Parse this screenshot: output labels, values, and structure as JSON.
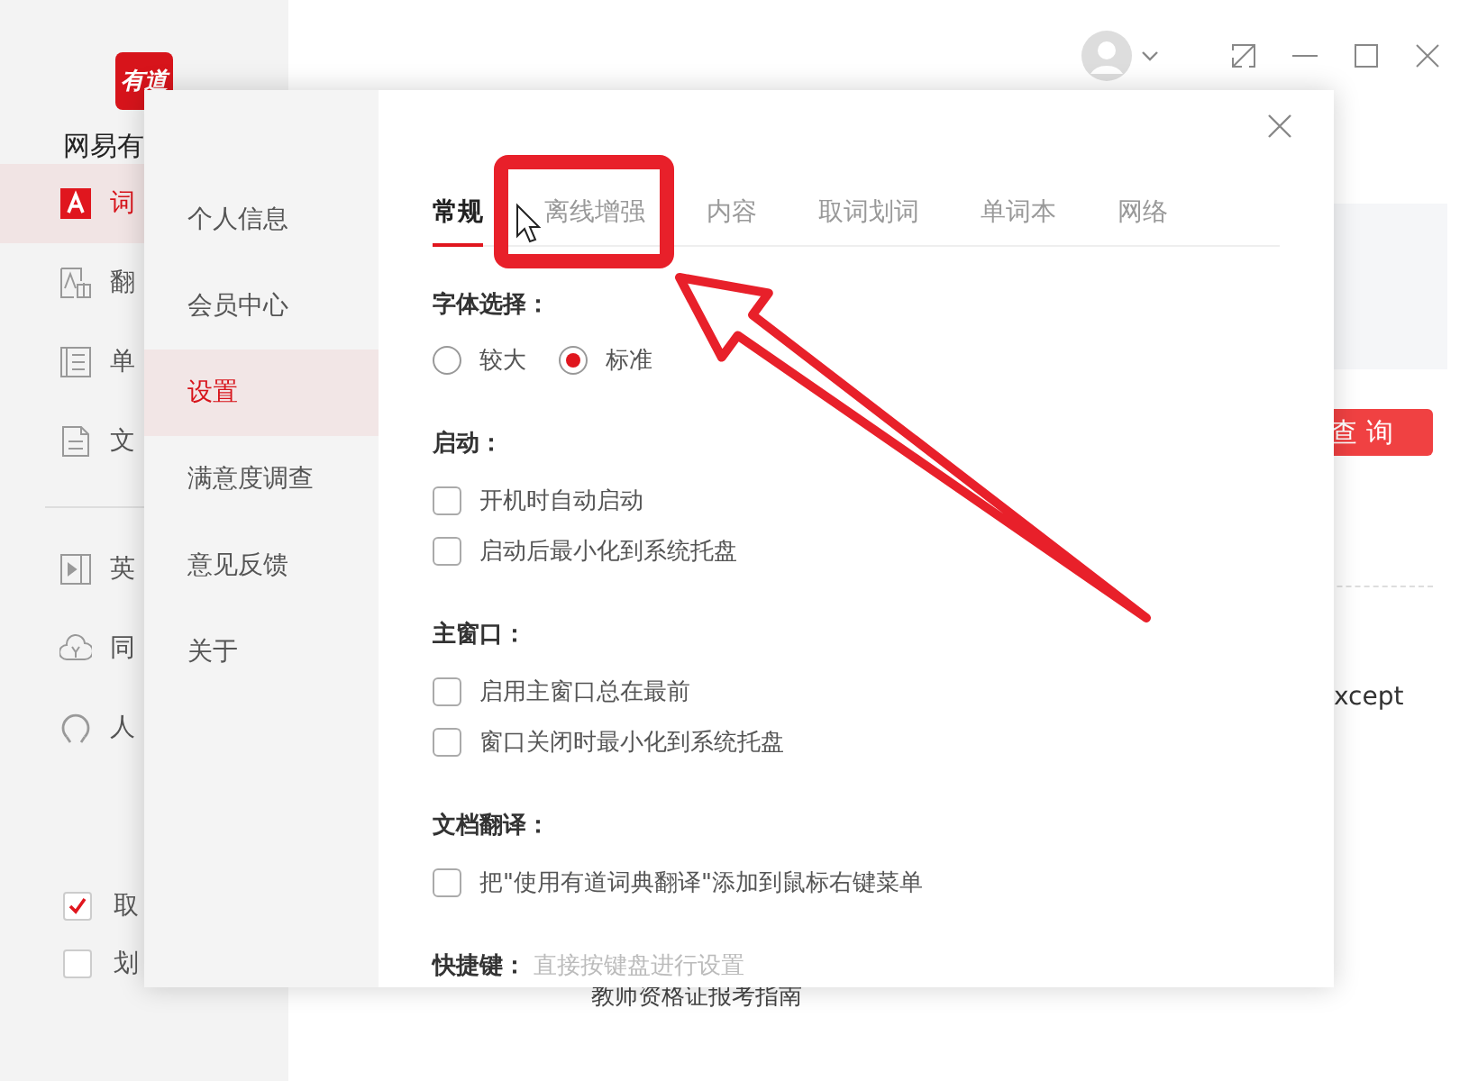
{
  "app": {
    "logo": "有道",
    "name": "网易有",
    "nav": [
      {
        "label": "词",
        "kind": "dict",
        "selected": true
      },
      {
        "label": "翻",
        "kind": "translate",
        "selected": false
      },
      {
        "label": "单",
        "kind": "wordbook",
        "selected": false
      },
      {
        "label": "文",
        "kind": "document",
        "selected": false
      }
    ],
    "nav_more": [
      {
        "label": "英",
        "kind": "video",
        "selected": false
      },
      {
        "label": "同",
        "kind": "cloud",
        "selected": false
      },
      {
        "label": "人",
        "kind": "headset",
        "selected": false
      }
    ],
    "toggles": [
      {
        "label": "取",
        "checked": true
      },
      {
        "label": "划",
        "checked": false
      }
    ],
    "query_button": "查 询",
    "snippet": "xcept",
    "bottom_text": "教师资格证报考指南"
  },
  "dialog": {
    "nav": [
      {
        "label": "个人信息",
        "selected": false
      },
      {
        "label": "会员中心",
        "selected": false
      },
      {
        "label": "设置",
        "selected": true
      },
      {
        "label": "满意度调查",
        "selected": false
      },
      {
        "label": "意见反馈",
        "selected": false
      },
      {
        "label": "关于",
        "selected": false
      }
    ],
    "tabs": [
      {
        "label": "常规",
        "selected": true
      },
      {
        "label": "离线增强",
        "selected": false
      },
      {
        "label": "内容",
        "selected": false
      },
      {
        "label": "取词划词",
        "selected": false
      },
      {
        "label": "单词本",
        "selected": false
      },
      {
        "label": "网络",
        "selected": false
      }
    ],
    "sections": [
      {
        "title": "字体选择：",
        "kind": "radio",
        "options": [
          {
            "label": "较大",
            "selected": false
          },
          {
            "label": "标准",
            "selected": true
          }
        ]
      },
      {
        "title": "启动：",
        "kind": "checkbox",
        "options": [
          {
            "label": "开机时自动启动",
            "checked": false
          },
          {
            "label": "启动后最小化到系统托盘",
            "checked": false
          }
        ]
      },
      {
        "title": "主窗口：",
        "kind": "checkbox",
        "options": [
          {
            "label": "启用主窗口总在最前",
            "checked": false
          },
          {
            "label": "窗口关闭时最小化到系统托盘",
            "checked": false
          }
        ]
      },
      {
        "title": "文档翻译：",
        "kind": "checkbox",
        "options": [
          {
            "label": "把\"使用有道词典翻译\"添加到鼠标右键菜单",
            "checked": false
          }
        ]
      },
      {
        "title": "快捷键：",
        "kind": "hint",
        "hint": "直接按键盘进行设置"
      }
    ]
  }
}
